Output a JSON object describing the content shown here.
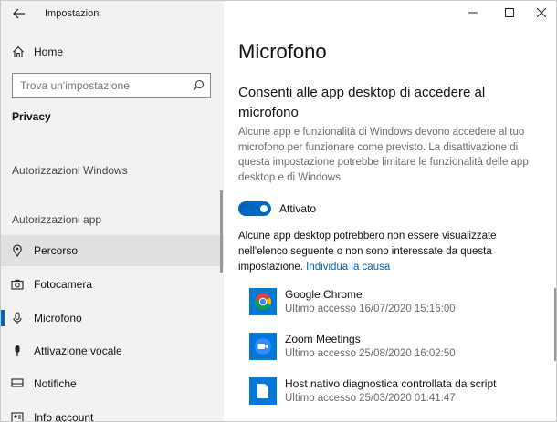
{
  "window": {
    "title": "Impostazioni"
  },
  "sidebar": {
    "home_label": "Home",
    "search_placeholder": "Trova un'impostazione",
    "section_title": "Privacy",
    "groups": [
      "Autorizzazioni Windows",
      "Autorizzazioni app"
    ],
    "items": [
      {
        "label": "Percorso",
        "icon": "location-icon"
      },
      {
        "label": "Fotocamera",
        "icon": "camera-icon"
      },
      {
        "label": "Microfono",
        "icon": "microphone-icon"
      },
      {
        "label": "Attivazione vocale",
        "icon": "voice-activation-icon"
      },
      {
        "label": "Notifiche",
        "icon": "notification-icon"
      },
      {
        "label": "Info account",
        "icon": "account-info-icon"
      }
    ]
  },
  "main": {
    "title": "Microfono",
    "heading": "Consenti alle app desktop di accedere al microfono",
    "description": "Alcune app e funzionalità di Windows devono accedere al tuo microfono per funzionare come previsto. La disattivazione di questa impostazione potrebbe limitare le funzionalità delle app desktop e di Windows.",
    "toggle_label": "Attivato",
    "toggle_on": true,
    "note": "Alcune app desktop potrebbero non essere visualizzate nell'elenco seguente o non sono interessate da questa impostazione.",
    "note_link": "Individua la causa",
    "apps": [
      {
        "name": "Google Chrome",
        "last_access": "Ultimo accesso 16/07/2020 15:16:00",
        "icon": "chrome-icon"
      },
      {
        "name": "Zoom Meetings",
        "last_access": "Ultimo accesso 25/08/2020 16:02:50",
        "icon": "zoom-icon"
      },
      {
        "name": "Host nativo diagnostica controllata da script",
        "last_access": "Ultimo accesso 25/03/2020 01:41:47",
        "icon": "document-icon"
      }
    ]
  },
  "colors": {
    "accent": "#0067c0",
    "app_tile": "#0078d7",
    "link": "#0063b1",
    "sidebar_bg": "#f2f2f2"
  }
}
